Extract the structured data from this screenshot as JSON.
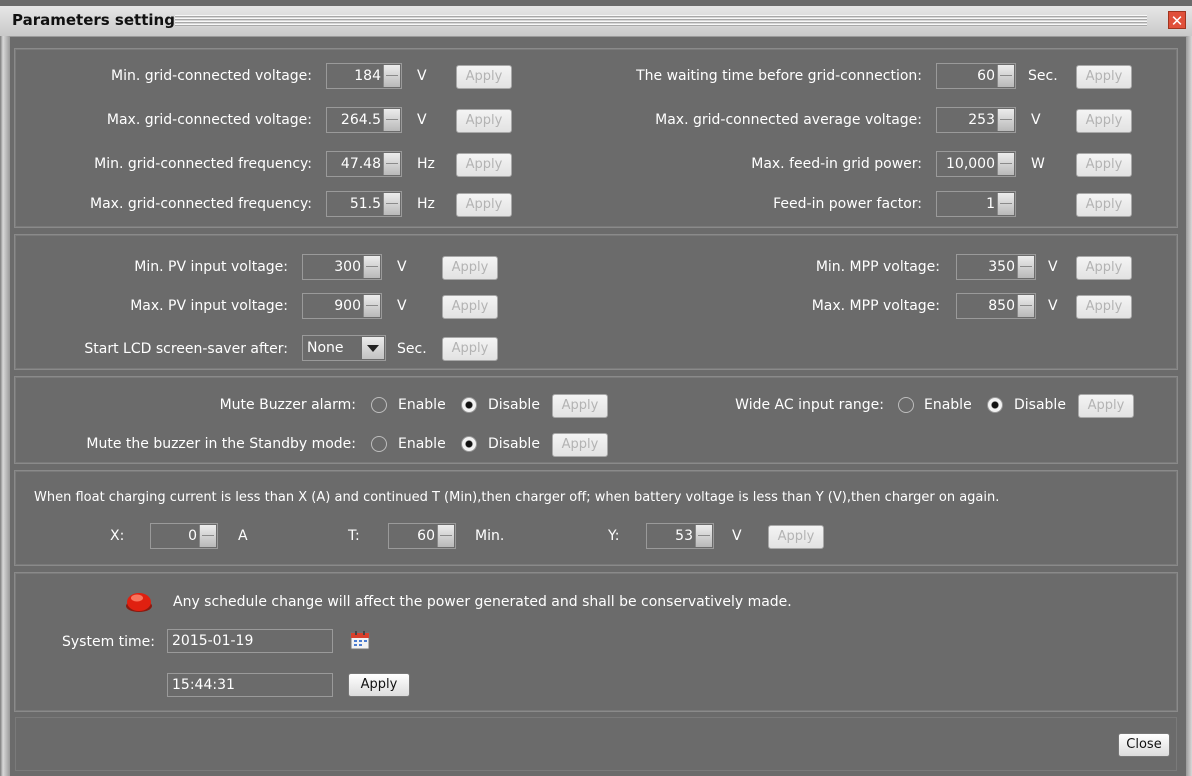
{
  "window": {
    "title": "Parameters setting",
    "close_glyph": "✕"
  },
  "apply": "Apply",
  "grid": {
    "left": [
      {
        "label": "Min. grid-connected voltage:",
        "value": "184",
        "unit": "V"
      },
      {
        "label": "Max. grid-connected voltage:",
        "value": "264.5",
        "unit": "V"
      },
      {
        "label": "Min. grid-connected frequency:",
        "value": "47.48",
        "unit": "Hz"
      },
      {
        "label": "Max. grid-connected frequency:",
        "value": "51.5",
        "unit": "Hz"
      }
    ],
    "right": [
      {
        "label": "The waiting time before grid-connection:",
        "value": "60",
        "unit": "Sec."
      },
      {
        "label": "Max. grid-connected average voltage:",
        "value": "253",
        "unit": "V"
      },
      {
        "label": "Max. feed-in grid power:",
        "value": "10,000",
        "unit": "W"
      },
      {
        "label": "Feed-in power factor:",
        "value": "1",
        "unit": ""
      }
    ]
  },
  "pv": {
    "left": [
      {
        "label": "Min. PV input voltage:",
        "value": "300",
        "unit": "V"
      },
      {
        "label": "Max. PV input voltage:",
        "value": "900",
        "unit": "V"
      }
    ],
    "right": [
      {
        "label": "Min. MPP voltage:",
        "value": "350",
        "unit": "V"
      },
      {
        "label": "Max. MPP voltage:",
        "value": "850",
        "unit": "V"
      }
    ],
    "screensaver": {
      "label": "Start LCD screen-saver after:",
      "value": "None",
      "unit": "Sec."
    }
  },
  "buzzer": {
    "enable": "Enable",
    "disable": "Disable",
    "mute_alarm": {
      "label": "Mute Buzzer alarm:",
      "selected": "Disable"
    },
    "mute_standby": {
      "label": "Mute the buzzer in the Standby mode:",
      "selected": "Disable"
    },
    "wide_ac": {
      "label": "Wide AC input range:",
      "selected": "Disable"
    }
  },
  "charger": {
    "description": "When float charging current is less than X (A) and continued T (Min),then charger off; when battery voltage is less than Y (V),then charger on again.",
    "x": {
      "label": "X:",
      "value": "0",
      "unit": "A"
    },
    "t": {
      "label": "T:",
      "value": "60",
      "unit": "Min."
    },
    "y": {
      "label": "Y:",
      "value": "53",
      "unit": "V"
    }
  },
  "system": {
    "warning": "Any schedule change will affect the power generated  and shall be conservatively made.",
    "time_label": "System time:",
    "date": "2015-01-19",
    "time": "15:44:31"
  },
  "footer": {
    "close": "Close"
  },
  "colors": {
    "window_bg": "#6b6b6b",
    "title_bg": "#dcdcdc",
    "led_red": "#e02010",
    "close_red": "#e0503a"
  },
  "icons": {
    "led": "red-led-icon",
    "calendar": "calendar-icon",
    "close": "close-icon"
  }
}
